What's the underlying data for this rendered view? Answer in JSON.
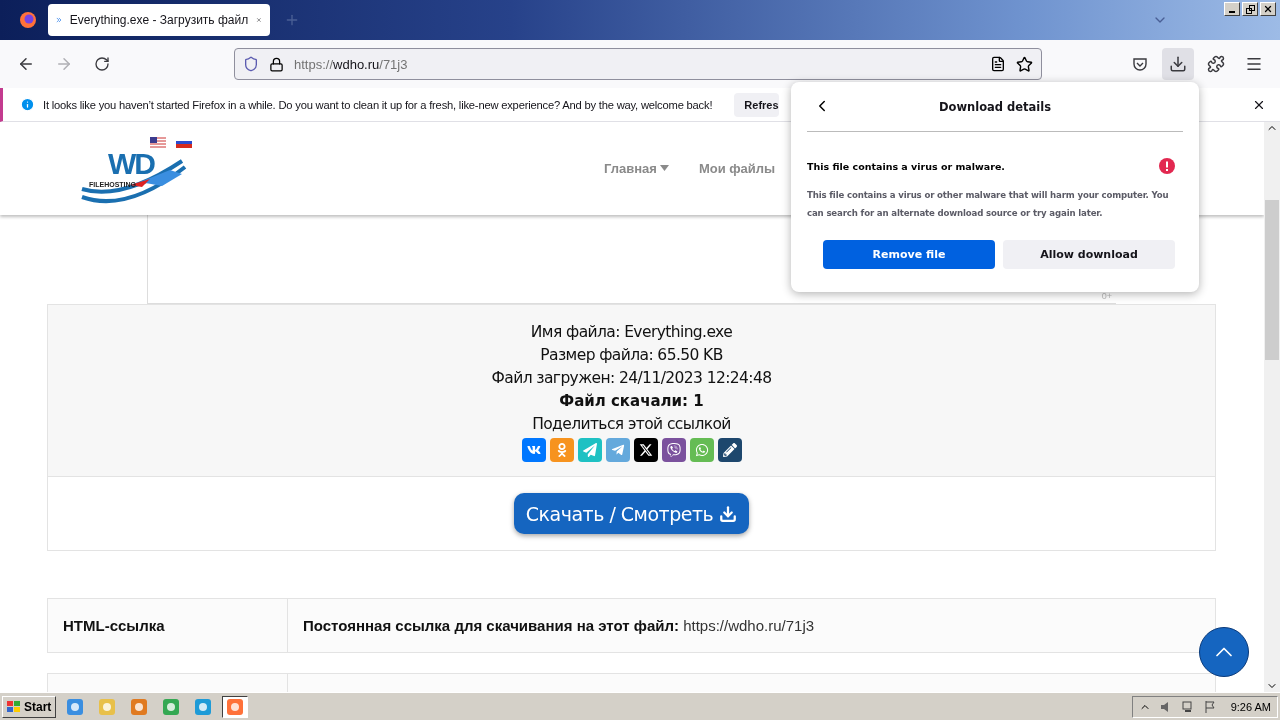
{
  "browser": {
    "tab_title": "Everything.exe - Загрузить файл",
    "url_scheme": "https://",
    "url_host": "wdho.ru",
    "url_path": "/71j3"
  },
  "notification": {
    "message": "It looks like you haven’t started Firefox in a while. Do you want to clean it up for a fresh, like-new experience? And by the way, welcome back!",
    "button": "Refres"
  },
  "download_panel": {
    "title": "Download details",
    "warning_title": "This file contains a virus or malware.",
    "warning_text": "This file contains a virus or other malware that will harm your computer. You can search for an alternate download source or try again later.",
    "buttons": [
      {
        "label": "Remove file",
        "primary": true
      },
      {
        "label": "Allow download",
        "primary": false
      }
    ]
  },
  "site": {
    "logo": {
      "mark": "WD",
      "tagline": "FILEHOSTING"
    },
    "nav": [
      {
        "label": "Главная",
        "dropdown": true
      },
      {
        "label": "Мои файлы",
        "dropdown": false
      }
    ],
    "ad_label": "0+",
    "file_info": [
      {
        "text": "Имя файла: Everything.exe",
        "emphasis": false
      },
      {
        "text": "Размер файла: 65.50 KB",
        "emphasis": false
      },
      {
        "text": "Файл загружен: 24/11/2023 12:24:48",
        "emphasis": false
      },
      {
        "text": "Файл скачали: 1",
        "emphasis": true
      },
      {
        "text": "Поделиться этой ссылкой",
        "emphasis": false
      }
    ],
    "share_buttons": [
      {
        "kind": "vk",
        "color": "#0077ff"
      },
      {
        "kind": "ok",
        "color": "#f7931e"
      },
      {
        "kind": "messenger",
        "color": "#1fc1c3"
      },
      {
        "kind": "telegram",
        "color": "#64a9dc"
      },
      {
        "kind": "x",
        "color": "#000000"
      },
      {
        "kind": "viber",
        "color": "#7b519d"
      },
      {
        "kind": "whatsapp",
        "color": "#65bc54"
      },
      {
        "kind": "journal",
        "color": "#1d476d"
      }
    ],
    "download_button": "Скачать / Смотреть",
    "links": [
      {
        "label": "HTML-ссылка",
        "description": "**Постоянная ссылка для скачивания на этот файл:** https://wdho.ru/71j3"
      }
    ]
  },
  "taskbar": {
    "start": "Start",
    "clock": "9:26 AM"
  }
}
